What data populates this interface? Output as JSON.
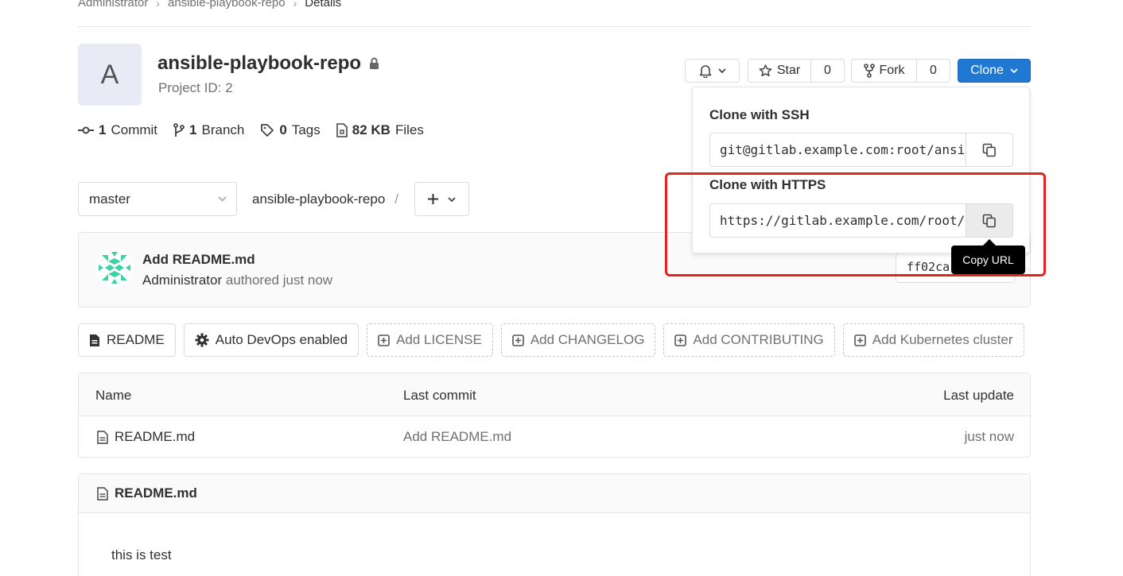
{
  "breadcrumb": {
    "items": [
      "Administrator",
      "ansible-playbook-repo"
    ],
    "current": "Details"
  },
  "project": {
    "avatar_letter": "A",
    "name": "ansible-playbook-repo",
    "id_text": "Project ID: 2"
  },
  "stats": {
    "commits_count": "1",
    "commits_label": "Commit",
    "branches_count": "1",
    "branches_label": "Branch",
    "tags_count": "0",
    "tags_label": "Tags",
    "files_size": "82 KB",
    "files_label": "Files"
  },
  "header_actions": {
    "star_label": "Star",
    "star_count": "0",
    "fork_label": "Fork",
    "fork_count": "0",
    "clone_label": "Clone"
  },
  "branch": {
    "selected": "master",
    "path": "ansible-playbook-repo",
    "separator": "/"
  },
  "last_commit": {
    "title": "Add README.md",
    "author": "Administrator",
    "time": "authored just now",
    "sha": "ff02ca"
  },
  "quick_actions": {
    "readme": "README",
    "auto_devops": "Auto DevOps enabled",
    "add_license": "Add LICENSE",
    "add_changelog": "Add CHANGELOG",
    "add_contributing": "Add CONTRIBUTING",
    "add_k8s": "Add Kubernetes cluster"
  },
  "file_table": {
    "headers": {
      "name": "Name",
      "last_commit": "Last commit",
      "last_update": "Last update"
    },
    "rows": [
      {
        "name": "README.md",
        "commit": "Add README.md",
        "update": "just now"
      }
    ]
  },
  "readme": {
    "title": "README.md",
    "body": "this is test"
  },
  "clone_dropdown": {
    "ssh_label": "Clone with SSH",
    "ssh_url": "git@gitlab.example.com:root/ansible-playbook-repo.git",
    "https_label": "Clone with HTTPS",
    "https_url": "https://gitlab.example.com/root/ansible-playbook-repo.git",
    "tooltip": "Copy URL"
  },
  "colors": {
    "primary": "#1f78d1",
    "highlight": "#e8221f",
    "avatar_bg": "#e8ebf6"
  }
}
